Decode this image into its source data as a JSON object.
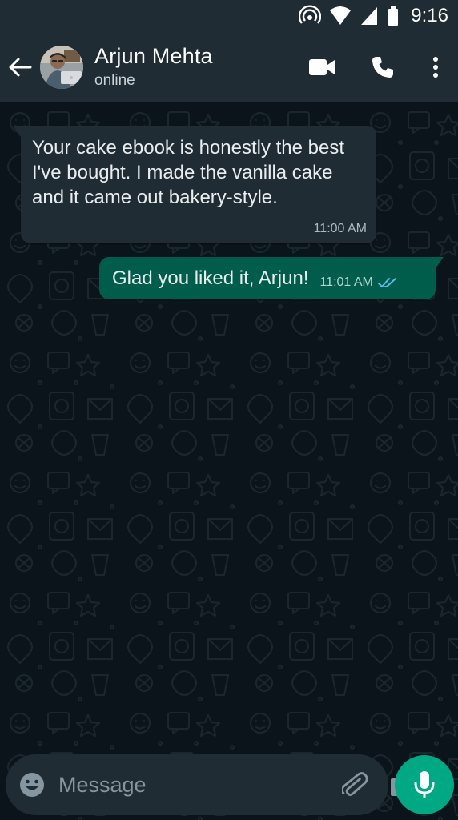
{
  "status_bar": {
    "time": "9:16"
  },
  "header": {
    "contact_name": "Arjun Mehta",
    "contact_status": "online",
    "icons": {
      "back": "arrow-left-icon",
      "video": "video-call-icon",
      "voice": "phone-icon",
      "more": "more-vertical-icon"
    }
  },
  "messages": [
    {
      "direction": "incoming",
      "text": "Your cake ebook is honestly the best I've bought. I made the vanilla cake and it came out bakery-style.",
      "time": "11:00 AM"
    },
    {
      "direction": "outgoing",
      "text": "Glad you liked it, Arjun!",
      "time": "11:01 AM",
      "read": true
    }
  ],
  "composer": {
    "placeholder": "Message",
    "value": "",
    "icons": {
      "emoji": "emoji-icon",
      "attach": "paperclip-icon",
      "camera": "camera-icon",
      "mic": "microphone-icon"
    }
  },
  "colors": {
    "app_bar": "#1f2c34",
    "chat_background": "#0b141a",
    "incoming_bubble": "#202c33",
    "outgoing_bubble": "#005c4b",
    "accent": "#00a884",
    "read_ticks": "#53bdeb"
  }
}
